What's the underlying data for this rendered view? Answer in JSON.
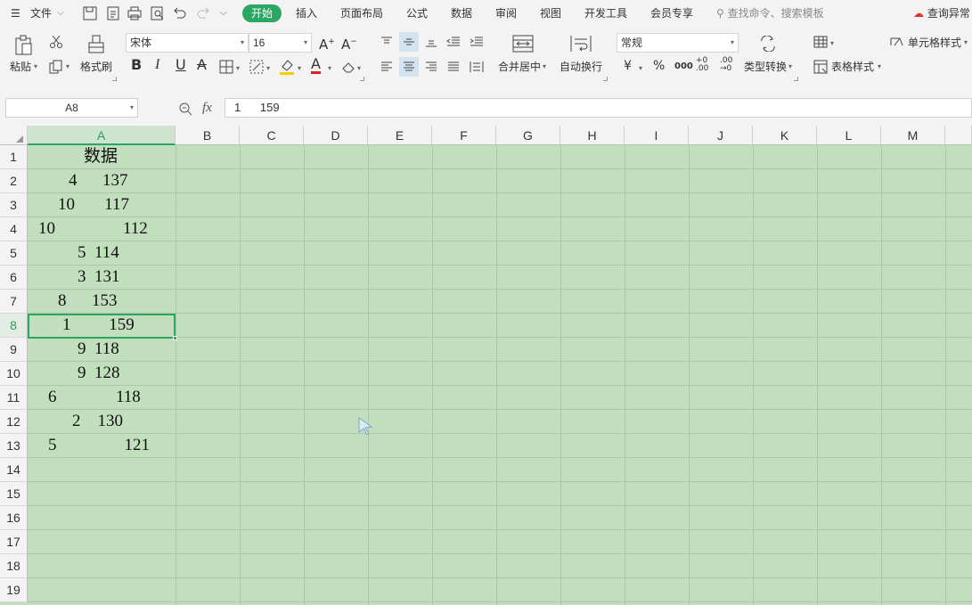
{
  "menu": {
    "file_label": "文件",
    "tabs": [
      "开始",
      "插入",
      "页面布局",
      "公式",
      "数据",
      "审阅",
      "视图",
      "开发工具",
      "会员专享"
    ],
    "search_placeholder": "查找命令、搜索模板",
    "right_link": "查询异常"
  },
  "ribbon": {
    "paste": "粘贴",
    "format_painter": "格式刷",
    "font_name": "宋体",
    "font_size": "16",
    "merge_center": "合并居中",
    "wrap_text": "自动换行",
    "number_format": "常规",
    "currency": "¥",
    "percent": "%",
    "thousands": "000",
    "inc_decimal": "+0 .00",
    "dec_decimal": ".00 →0",
    "type_convert": "类型转换",
    "table_style": "表格样式",
    "cell_style": "单元格样式",
    "bold": "B",
    "italic": "I",
    "underline": "U",
    "strike": "A",
    "font_color": "A"
  },
  "formula_bar": {
    "name_box": "A8",
    "fx": "fx",
    "content": "1      159"
  },
  "sheet": {
    "columns": [
      "A",
      "B",
      "C",
      "D",
      "E",
      "F",
      "G",
      "H",
      "I",
      "J",
      "K",
      "L",
      "M"
    ],
    "rows": [
      "1",
      "2",
      "3",
      "4",
      "5",
      "6",
      "7",
      "8",
      "9",
      "10",
      "11",
      "12",
      "13",
      "14",
      "15",
      "16",
      "17",
      "18",
      "19"
    ],
    "selected_cell": "A8",
    "cells_A": [
      "数据",
      "4      137",
      "10       117",
      "10                112",
      "5  114",
      "3  131",
      "8      153",
      "1         159",
      "9  118",
      "9  128",
      "6              118",
      "2    130",
      "5                121"
    ]
  },
  "colors": {
    "accent": "#2aa763",
    "sheet_bg": "#c2dfbd"
  }
}
